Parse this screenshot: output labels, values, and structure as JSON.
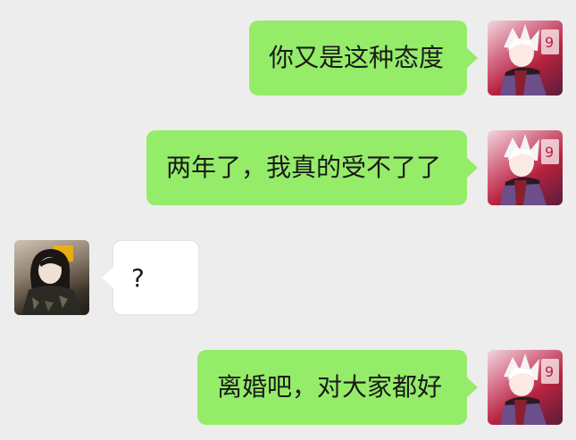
{
  "messages": [
    {
      "sender": "me",
      "text": "你又是这种态度",
      "avatar_icon": "anime-avatar-icon"
    },
    {
      "sender": "me",
      "text": "两年了，我真的受不了了",
      "avatar_icon": "anime-avatar-icon"
    },
    {
      "sender": "other",
      "text": "?",
      "avatar_icon": "woman-avatar-icon"
    },
    {
      "sender": "me",
      "text": "离婚吧，对大家都好",
      "avatar_icon": "anime-avatar-icon"
    }
  ],
  "colors": {
    "background": "#ededed",
    "my_bubble": "#95ec69",
    "their_bubble": "#ffffff"
  }
}
